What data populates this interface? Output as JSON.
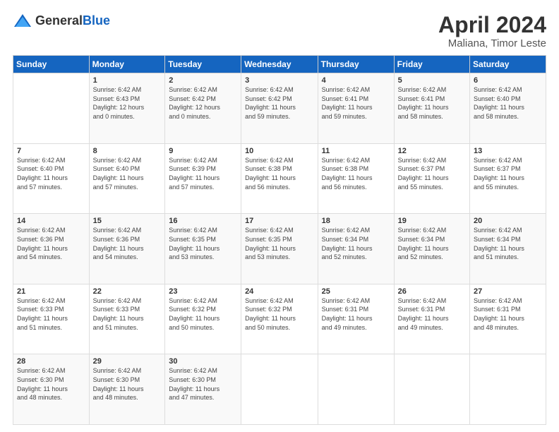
{
  "header": {
    "logo_general": "General",
    "logo_blue": "Blue",
    "month_title": "April 2024",
    "location": "Maliana, Timor Leste"
  },
  "days_of_week": [
    "Sunday",
    "Monday",
    "Tuesday",
    "Wednesday",
    "Thursday",
    "Friday",
    "Saturday"
  ],
  "weeks": [
    [
      {
        "num": "",
        "info": ""
      },
      {
        "num": "1",
        "info": "Sunrise: 6:42 AM\nSunset: 6:43 PM\nDaylight: 12 hours\nand 0 minutes."
      },
      {
        "num": "2",
        "info": "Sunrise: 6:42 AM\nSunset: 6:42 PM\nDaylight: 12 hours\nand 0 minutes."
      },
      {
        "num": "3",
        "info": "Sunrise: 6:42 AM\nSunset: 6:42 PM\nDaylight: 11 hours\nand 59 minutes."
      },
      {
        "num": "4",
        "info": "Sunrise: 6:42 AM\nSunset: 6:41 PM\nDaylight: 11 hours\nand 59 minutes."
      },
      {
        "num": "5",
        "info": "Sunrise: 6:42 AM\nSunset: 6:41 PM\nDaylight: 11 hours\nand 58 minutes."
      },
      {
        "num": "6",
        "info": "Sunrise: 6:42 AM\nSunset: 6:40 PM\nDaylight: 11 hours\nand 58 minutes."
      }
    ],
    [
      {
        "num": "7",
        "info": "Sunrise: 6:42 AM\nSunset: 6:40 PM\nDaylight: 11 hours\nand 57 minutes."
      },
      {
        "num": "8",
        "info": "Sunrise: 6:42 AM\nSunset: 6:40 PM\nDaylight: 11 hours\nand 57 minutes."
      },
      {
        "num": "9",
        "info": "Sunrise: 6:42 AM\nSunset: 6:39 PM\nDaylight: 11 hours\nand 57 minutes."
      },
      {
        "num": "10",
        "info": "Sunrise: 6:42 AM\nSunset: 6:38 PM\nDaylight: 11 hours\nand 56 minutes."
      },
      {
        "num": "11",
        "info": "Sunrise: 6:42 AM\nSunset: 6:38 PM\nDaylight: 11 hours\nand 56 minutes."
      },
      {
        "num": "12",
        "info": "Sunrise: 6:42 AM\nSunset: 6:37 PM\nDaylight: 11 hours\nand 55 minutes."
      },
      {
        "num": "13",
        "info": "Sunrise: 6:42 AM\nSunset: 6:37 PM\nDaylight: 11 hours\nand 55 minutes."
      }
    ],
    [
      {
        "num": "14",
        "info": "Sunrise: 6:42 AM\nSunset: 6:36 PM\nDaylight: 11 hours\nand 54 minutes."
      },
      {
        "num": "15",
        "info": "Sunrise: 6:42 AM\nSunset: 6:36 PM\nDaylight: 11 hours\nand 54 minutes."
      },
      {
        "num": "16",
        "info": "Sunrise: 6:42 AM\nSunset: 6:35 PM\nDaylight: 11 hours\nand 53 minutes."
      },
      {
        "num": "17",
        "info": "Sunrise: 6:42 AM\nSunset: 6:35 PM\nDaylight: 11 hours\nand 53 minutes."
      },
      {
        "num": "18",
        "info": "Sunrise: 6:42 AM\nSunset: 6:34 PM\nDaylight: 11 hours\nand 52 minutes."
      },
      {
        "num": "19",
        "info": "Sunrise: 6:42 AM\nSunset: 6:34 PM\nDaylight: 11 hours\nand 52 minutes."
      },
      {
        "num": "20",
        "info": "Sunrise: 6:42 AM\nSunset: 6:34 PM\nDaylight: 11 hours\nand 51 minutes."
      }
    ],
    [
      {
        "num": "21",
        "info": "Sunrise: 6:42 AM\nSunset: 6:33 PM\nDaylight: 11 hours\nand 51 minutes."
      },
      {
        "num": "22",
        "info": "Sunrise: 6:42 AM\nSunset: 6:33 PM\nDaylight: 11 hours\nand 51 minutes."
      },
      {
        "num": "23",
        "info": "Sunrise: 6:42 AM\nSunset: 6:32 PM\nDaylight: 11 hours\nand 50 minutes."
      },
      {
        "num": "24",
        "info": "Sunrise: 6:42 AM\nSunset: 6:32 PM\nDaylight: 11 hours\nand 50 minutes."
      },
      {
        "num": "25",
        "info": "Sunrise: 6:42 AM\nSunset: 6:31 PM\nDaylight: 11 hours\nand 49 minutes."
      },
      {
        "num": "26",
        "info": "Sunrise: 6:42 AM\nSunset: 6:31 PM\nDaylight: 11 hours\nand 49 minutes."
      },
      {
        "num": "27",
        "info": "Sunrise: 6:42 AM\nSunset: 6:31 PM\nDaylight: 11 hours\nand 48 minutes."
      }
    ],
    [
      {
        "num": "28",
        "info": "Sunrise: 6:42 AM\nSunset: 6:30 PM\nDaylight: 11 hours\nand 48 minutes."
      },
      {
        "num": "29",
        "info": "Sunrise: 6:42 AM\nSunset: 6:30 PM\nDaylight: 11 hours\nand 48 minutes."
      },
      {
        "num": "30",
        "info": "Sunrise: 6:42 AM\nSunset: 6:30 PM\nDaylight: 11 hours\nand 47 minutes."
      },
      {
        "num": "",
        "info": ""
      },
      {
        "num": "",
        "info": ""
      },
      {
        "num": "",
        "info": ""
      },
      {
        "num": "",
        "info": ""
      }
    ]
  ]
}
